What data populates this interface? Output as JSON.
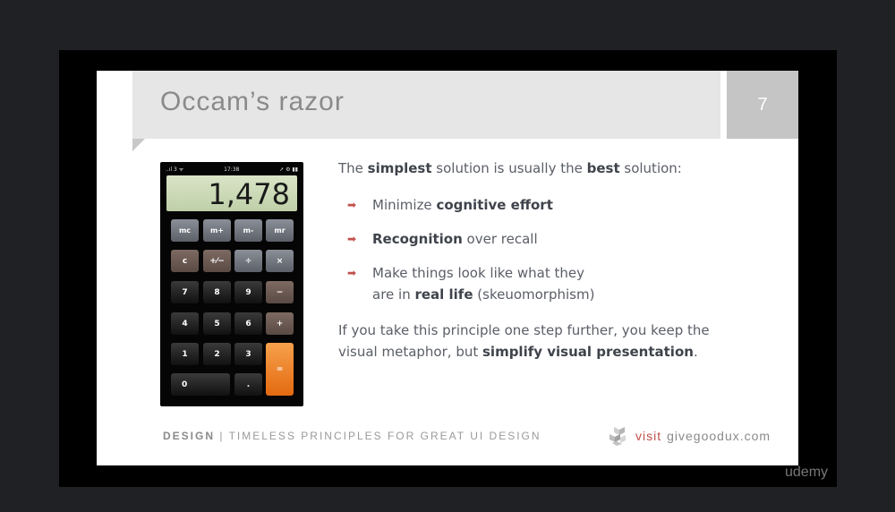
{
  "slide": {
    "title": "Occam’s razor",
    "page_number": "7"
  },
  "phone": {
    "status_left": "..ıl 3 ᯤ",
    "status_time": "17:38",
    "status_right": "➚ ⚙ ▮▮",
    "display": "1,478",
    "keys": {
      "mc": "mc",
      "mplus": "m+",
      "mminus": "m-",
      "mr": "mr",
      "c": "c",
      "plusminus": "+⁄−",
      "divide": "÷",
      "times": "×",
      "seven": "7",
      "eight": "8",
      "nine": "9",
      "minus": "−",
      "four": "4",
      "five": "5",
      "six": "6",
      "plus": "+",
      "one": "1",
      "two": "2",
      "three": "3",
      "zero": "0",
      "dot": ".",
      "equals": "="
    }
  },
  "content": {
    "intro_1": "The ",
    "intro_b1": "simplest",
    "intro_2": " solution is usually the ",
    "intro_b2": "best",
    "intro_3": " solution:",
    "bullet1_a": "Minimize ",
    "bullet1_b": "cognitive effort",
    "bullet2_b": "Recognition",
    "bullet2_a": " over recall",
    "bullet3_line1": "Make things look like what they",
    "bullet3_a": "are in ",
    "bullet3_b": "real life",
    "bullet3_c": " (skeuomorphism)",
    "para_1": "If you take this principle one step further, you keep the",
    "para_2": "visual metaphor, but ",
    "para_b": "simplify visual presentation",
    "para_3": "."
  },
  "footer": {
    "design": "DESIGN",
    "separator": " | ",
    "tagline": "TIMELESS PRINCIPLES FOR GREAT UI DESIGN",
    "visit_label": "visit",
    "site": "givegoodux.com"
  },
  "watermark": "udemy",
  "colors": {
    "accent_red": "#c0504d",
    "equals_orange": "#e36a10",
    "title_band": "#e6e6e6",
    "page_box": "#c5c5c5"
  }
}
